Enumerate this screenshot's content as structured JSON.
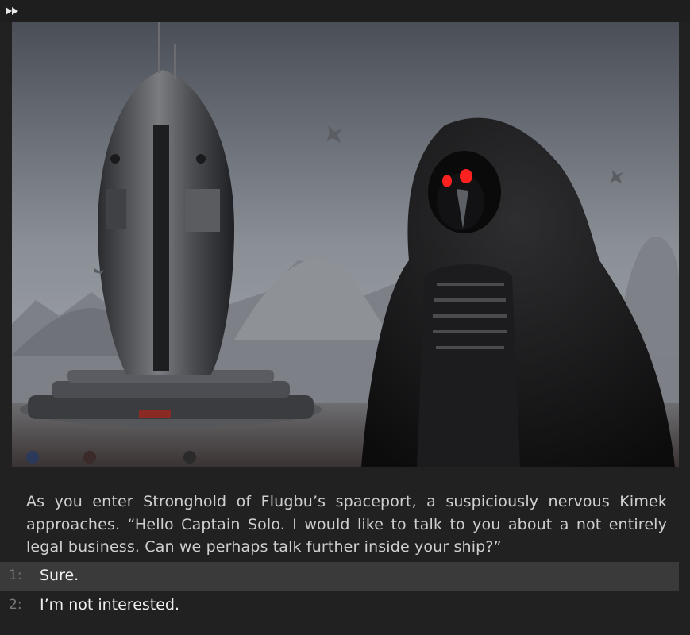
{
  "toolbar": {
    "fast_forward_icon": "fast-forward-icon"
  },
  "scene": {
    "image_alt": "Hooded Kimek figure standing before a tall rocket-shaped spaceship tower on a misty alien plain"
  },
  "narration": {
    "text": "As you enter Stronghold of Flugbu’s spaceport, a suspiciously nervous Kimek approaches. “Hello Captain Solo. I would like to talk to you about a not entirely legal business. Can we perhaps talk further inside your ship?”"
  },
  "choices": [
    {
      "number": "1:",
      "label": "Sure."
    },
    {
      "number": "2:",
      "label": "I’m not interested."
    }
  ],
  "colors": {
    "background": "#212121",
    "selected_choice": "#3a3a3a",
    "eye_red": "#ff2020"
  }
}
